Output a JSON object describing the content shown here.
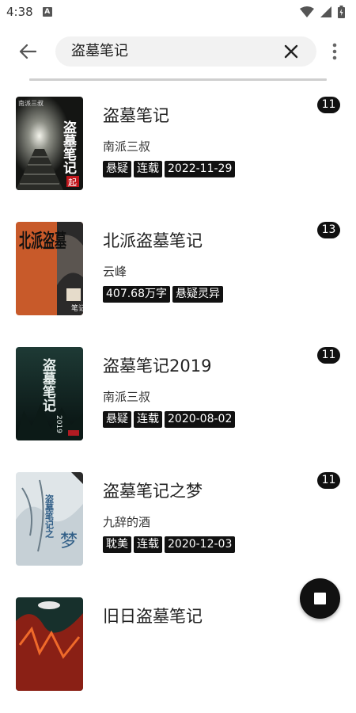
{
  "status_bar": {
    "time": "4:38",
    "notif_letter": "A"
  },
  "search": {
    "query": "盗墓笔记"
  },
  "books": [
    {
      "title": "盗墓笔记",
      "author": "南派三叔",
      "tags": [
        "悬疑",
        "连载",
        "2022-11-29"
      ],
      "count": "11",
      "cover_title": "盗墓笔记",
      "cover_author": "南派三叔",
      "cover_badge": "起"
    },
    {
      "title": "北派盗墓笔记",
      "author": "云峰",
      "tags": [
        "407.68万字",
        "悬疑灵异"
      ],
      "count": "13",
      "cover_title": "北派盗墓",
      "cover_sub": "笔记"
    },
    {
      "title": "盗墓笔记2019",
      "author": "南派三叔",
      "tags": [
        "悬疑",
        "连载",
        "2020-08-02"
      ],
      "count": "11",
      "cover_title": "盗墓笔记",
      "cover_sub": "2019"
    },
    {
      "title": "盗墓笔记之梦",
      "author": "九辞的酒",
      "tags": [
        "耽美",
        "连载",
        "2020-12-03"
      ],
      "count": "11",
      "cover_title": "盗墓笔记之",
      "cover_sub": "梦"
    },
    {
      "title": "旧日盗墓笔记",
      "author": "",
      "tags": [],
      "count": ""
    }
  ],
  "icons": {
    "back": "arrow-left-icon",
    "clear": "close-icon",
    "more": "more-vert-icon",
    "fab": "stop-icon",
    "wifi": "wifi-icon",
    "signal": "signal-icon",
    "battery": "battery-icon"
  }
}
